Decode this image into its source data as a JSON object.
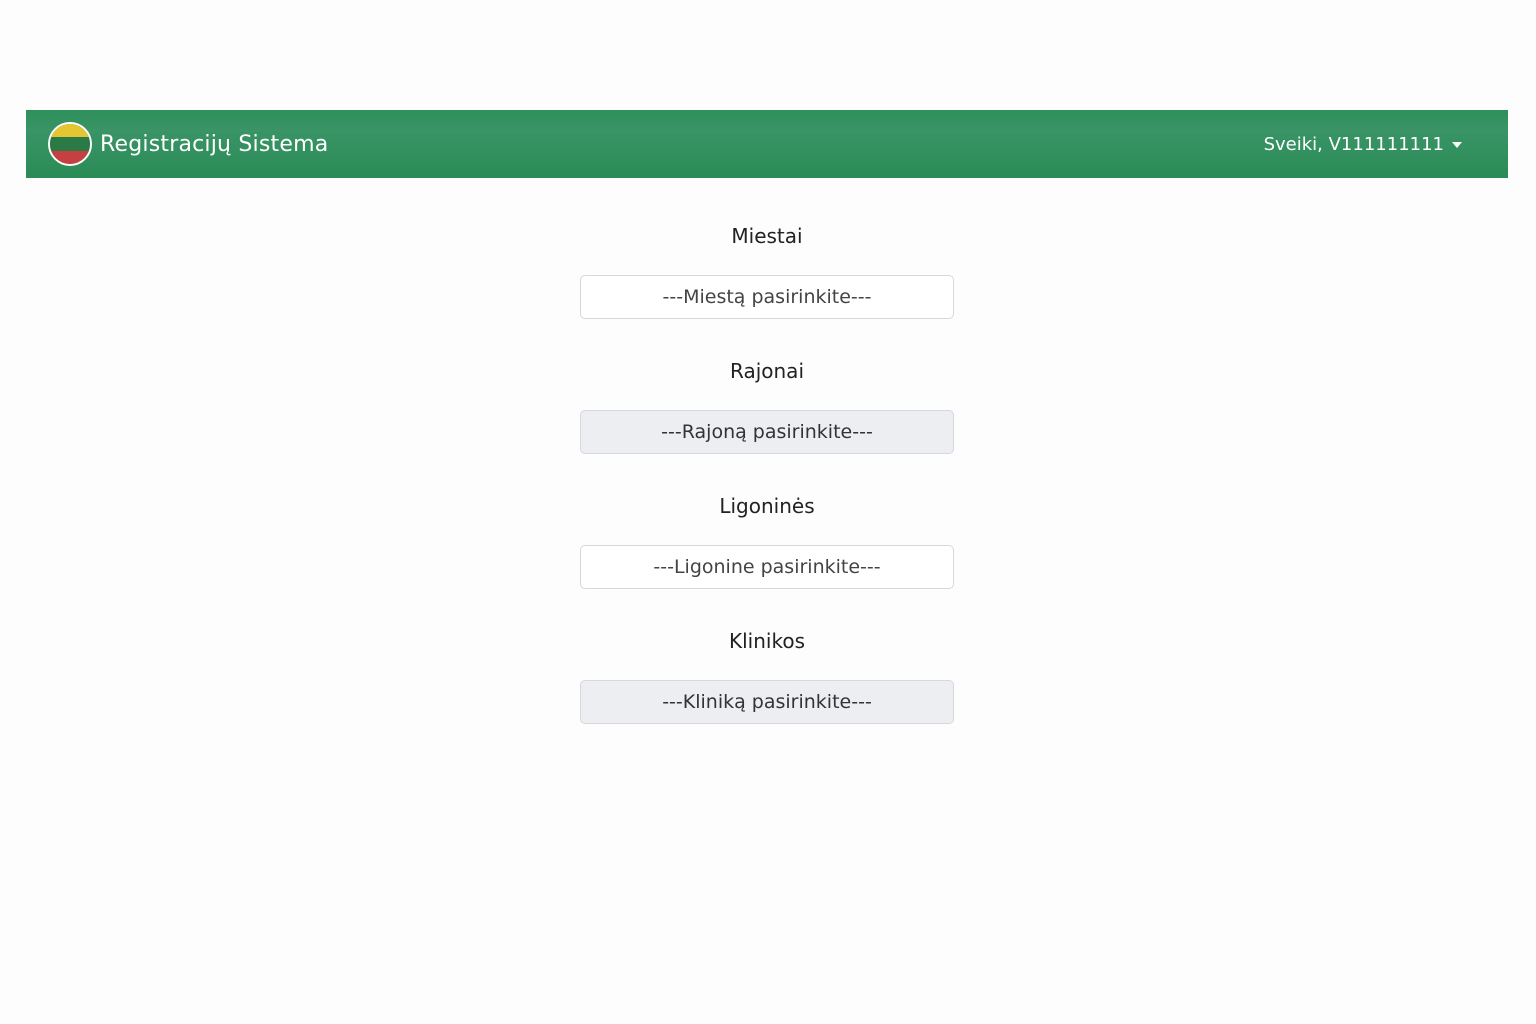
{
  "navbar": {
    "brand_title": "Registracijų Sistema",
    "user_greeting": "Sveiki, V111111111",
    "background_color": "#2e8f5a",
    "flag_colors": [
      "#e4c532",
      "#2b7a45",
      "#c64041"
    ]
  },
  "form": {
    "fields": [
      {
        "label": "Miestai",
        "select_value": "---Miestą pasirinkite---",
        "state": "enabled"
      },
      {
        "label": "Rajonai",
        "select_value": "---Rajoną pasirinkite---",
        "state": "disabled"
      },
      {
        "label": "Ligoninės",
        "select_value": "---Ligonine pasirinkite---",
        "state": "enabled"
      },
      {
        "label": "Klinikos",
        "select_value": "---Kliniką pasirinkite---",
        "state": "disabled"
      }
    ]
  }
}
